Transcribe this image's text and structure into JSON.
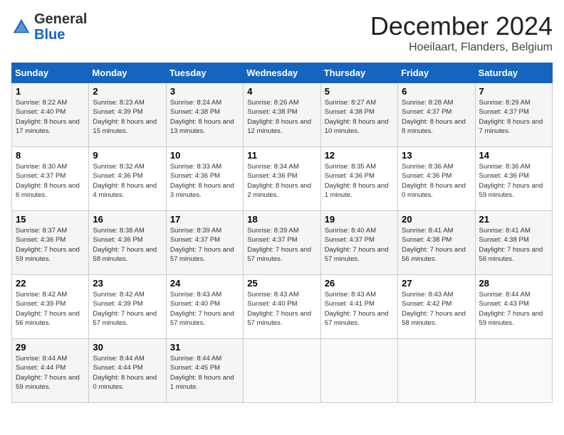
{
  "header": {
    "logo_general": "General",
    "logo_blue": "Blue",
    "month_title": "December 2024",
    "subtitle": "Hoeilaart, Flanders, Belgium"
  },
  "days_of_week": [
    "Sunday",
    "Monday",
    "Tuesday",
    "Wednesday",
    "Thursday",
    "Friday",
    "Saturday"
  ],
  "weeks": [
    [
      {
        "day": "1",
        "sunrise": "8:22 AM",
        "sunset": "4:40 PM",
        "daylight": "8 hours and 17 minutes."
      },
      {
        "day": "2",
        "sunrise": "8:23 AM",
        "sunset": "4:39 PM",
        "daylight": "8 hours and 15 minutes."
      },
      {
        "day": "3",
        "sunrise": "8:24 AM",
        "sunset": "4:38 PM",
        "daylight": "8 hours and 13 minutes."
      },
      {
        "day": "4",
        "sunrise": "8:26 AM",
        "sunset": "4:38 PM",
        "daylight": "8 hours and 12 minutes."
      },
      {
        "day": "5",
        "sunrise": "8:27 AM",
        "sunset": "4:38 PM",
        "daylight": "8 hours and 10 minutes."
      },
      {
        "day": "6",
        "sunrise": "8:28 AM",
        "sunset": "4:37 PM",
        "daylight": "8 hours and 8 minutes."
      },
      {
        "day": "7",
        "sunrise": "8:29 AM",
        "sunset": "4:37 PM",
        "daylight": "8 hours and 7 minutes."
      }
    ],
    [
      {
        "day": "8",
        "sunrise": "8:30 AM",
        "sunset": "4:37 PM",
        "daylight": "8 hours and 6 minutes."
      },
      {
        "day": "9",
        "sunrise": "8:32 AM",
        "sunset": "4:36 PM",
        "daylight": "8 hours and 4 minutes."
      },
      {
        "day": "10",
        "sunrise": "8:33 AM",
        "sunset": "4:36 PM",
        "daylight": "8 hours and 3 minutes."
      },
      {
        "day": "11",
        "sunrise": "8:34 AM",
        "sunset": "4:36 PM",
        "daylight": "8 hours and 2 minutes."
      },
      {
        "day": "12",
        "sunrise": "8:35 AM",
        "sunset": "4:36 PM",
        "daylight": "8 hours and 1 minute."
      },
      {
        "day": "13",
        "sunrise": "8:36 AM",
        "sunset": "4:36 PM",
        "daylight": "8 hours and 0 minutes."
      },
      {
        "day": "14",
        "sunrise": "8:36 AM",
        "sunset": "4:36 PM",
        "daylight": "7 hours and 59 minutes."
      }
    ],
    [
      {
        "day": "15",
        "sunrise": "8:37 AM",
        "sunset": "4:36 PM",
        "daylight": "7 hours and 59 minutes."
      },
      {
        "day": "16",
        "sunrise": "8:38 AM",
        "sunset": "4:36 PM",
        "daylight": "7 hours and 58 minutes."
      },
      {
        "day": "17",
        "sunrise": "8:39 AM",
        "sunset": "4:37 PM",
        "daylight": "7 hours and 57 minutes."
      },
      {
        "day": "18",
        "sunrise": "8:39 AM",
        "sunset": "4:37 PM",
        "daylight": "7 hours and 57 minutes."
      },
      {
        "day": "19",
        "sunrise": "8:40 AM",
        "sunset": "4:37 PM",
        "daylight": "7 hours and 57 minutes."
      },
      {
        "day": "20",
        "sunrise": "8:41 AM",
        "sunset": "4:38 PM",
        "daylight": "7 hours and 56 minutes."
      },
      {
        "day": "21",
        "sunrise": "8:41 AM",
        "sunset": "4:38 PM",
        "daylight": "7 hours and 56 minutes."
      }
    ],
    [
      {
        "day": "22",
        "sunrise": "8:42 AM",
        "sunset": "4:39 PM",
        "daylight": "7 hours and 56 minutes."
      },
      {
        "day": "23",
        "sunrise": "8:42 AM",
        "sunset": "4:39 PM",
        "daylight": "7 hours and 57 minutes."
      },
      {
        "day": "24",
        "sunrise": "8:43 AM",
        "sunset": "4:40 PM",
        "daylight": "7 hours and 57 minutes."
      },
      {
        "day": "25",
        "sunrise": "8:43 AM",
        "sunset": "4:40 PM",
        "daylight": "7 hours and 57 minutes."
      },
      {
        "day": "26",
        "sunrise": "8:43 AM",
        "sunset": "4:41 PM",
        "daylight": "7 hours and 57 minutes."
      },
      {
        "day": "27",
        "sunrise": "8:43 AM",
        "sunset": "4:42 PM",
        "daylight": "7 hours and 58 minutes."
      },
      {
        "day": "28",
        "sunrise": "8:44 AM",
        "sunset": "4:43 PM",
        "daylight": "7 hours and 59 minutes."
      }
    ],
    [
      {
        "day": "29",
        "sunrise": "8:44 AM",
        "sunset": "4:44 PM",
        "daylight": "7 hours and 59 minutes."
      },
      {
        "day": "30",
        "sunrise": "8:44 AM",
        "sunset": "4:44 PM",
        "daylight": "8 hours and 0 minutes."
      },
      {
        "day": "31",
        "sunrise": "8:44 AM",
        "sunset": "4:45 PM",
        "daylight": "8 hours and 1 minute."
      },
      null,
      null,
      null,
      null
    ]
  ]
}
